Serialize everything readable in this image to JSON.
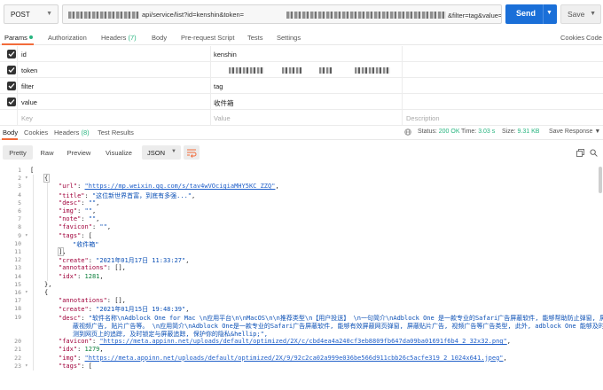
{
  "request": {
    "method": "POST",
    "url_path_visible": "api/service/list?id=kenshin&token=",
    "url_suffix_visible": "&filter=tag&value=收件箱",
    "send_label": "Send",
    "save_label": "Save"
  },
  "request_tabs": {
    "params": "Params",
    "authorization": "Authorization",
    "headers": "Headers",
    "headers_count": "(7)",
    "body": "Body",
    "prerequest": "Pre-request Script",
    "tests": "Tests",
    "settings": "Settings",
    "cookies": "Cookies",
    "code": "Code"
  },
  "params": [
    {
      "key": "id",
      "value": "kenshin",
      "value_redacted": false
    },
    {
      "key": "token",
      "value": "",
      "value_redacted": true
    },
    {
      "key": "filter",
      "value": "tag",
      "value_redacted": false
    },
    {
      "key": "value",
      "value": "收件箱",
      "value_redacted": false
    }
  ],
  "params_placeholder": {
    "key": "Key",
    "value": "Value",
    "description": "Description"
  },
  "response_tabs": {
    "body": "Body",
    "cookies": "Cookies",
    "headers": "Headers",
    "headers_count": "(8)",
    "test_results": "Test Results",
    "status_label": "Status:",
    "status_value": "200 OK",
    "time_label": "Time:",
    "time_value": "3.03 s",
    "size_label": "Size:",
    "size_value": "9.31 KB",
    "save_response": "Save Response"
  },
  "response_toolbar": {
    "pretty": "Pretty",
    "raw": "Raw",
    "preview": "Preview",
    "visualize": "Visualize",
    "format": "JSON"
  },
  "code_lines": [
    {
      "n": "1",
      "text": "[",
      "indent": 0
    },
    {
      "n": "2",
      "text": "{",
      "indent": 1
    },
    {
      "n": "3",
      "k": "\"url\"",
      "v": "\"https://mp.weixin.qq.com/s/tav4wVOcigiaMHY5KC_ZZQ\"",
      "t": "link",
      "indent": 2
    },
    {
      "n": "4",
      "k": "\"title\"",
      "v": "\"这位新世界首富，到底有多强...\"",
      "t": "str",
      "indent": 2
    },
    {
      "n": "5",
      "k": "\"desc\"",
      "v": "\"\"",
      "t": "str",
      "indent": 2
    },
    {
      "n": "6",
      "k": "\"img\"",
      "v": "\"\"",
      "t": "str",
      "indent": 2
    },
    {
      "n": "7",
      "k": "\"note\"",
      "v": "\"\"",
      "t": "str",
      "indent": 2
    },
    {
      "n": "8",
      "k": "\"favicon\"",
      "v": "\"\"",
      "t": "str",
      "indent": 2
    },
    {
      "n": "9",
      "k": "\"tags\"",
      "v": "[",
      "t": "pun",
      "indent": 2
    },
    {
      "n": "10",
      "text": "\"收件箱\"",
      "t": "str",
      "indent": 3
    },
    {
      "n": "11",
      "text": "],",
      "indent": 2
    },
    {
      "n": "12",
      "k": "\"create\"",
      "v": "\"2021年01月17日 11:33:27\"",
      "t": "str",
      "indent": 2
    },
    {
      "n": "13",
      "k": "\"annotations\"",
      "v": "[]",
      "t": "pun",
      "indent": 2
    },
    {
      "n": "14",
      "k": "\"idx\"",
      "v": "1281",
      "t": "num",
      "indent": 2
    },
    {
      "n": "15",
      "text": "},",
      "indent": 1
    },
    {
      "n": "16",
      "text": "{",
      "indent": 1
    },
    {
      "n": "17",
      "k": "\"annotations\"",
      "v": "[]",
      "t": "pun",
      "indent": 2
    },
    {
      "n": "18",
      "k": "\"create\"",
      "v": "\"2021年01月15日 19:48:39\"",
      "t": "str",
      "indent": 2
    },
    {
      "n": "19",
      "k": "\"desc\"",
      "v": "\"软件名称\\nAdblock One for Mac \\n应用平台\\n\\nMacOS\\n\\n推荐类型\\n【用户投送】 \\n一句简介\\nAdblock One 是一款专业的Safari广告屏蔽软件, 能够帮助防止弹窗, 屏",
      "t": "str",
      "indent": 2
    },
    {
      "n": "",
      "text": "蔽视频广告, 贴片广告等。 \\n应用简介\\nAdblock One是一款专业的Safari广告屏蔽软件, 能够有效屏蔽网页弹窗, 屏蔽贴片广告, 视频广告等广告类型, 此外, adblock One 能够及时侦",
      "t": "str",
      "indent": 3
    },
    {
      "n": "",
      "text": "测到网页上的追踪, 及时锁定与屏蔽追踪, 保护你的隐私&hellip;\",",
      "t": "str",
      "indent": 3
    },
    {
      "n": "20",
      "k": "\"favicon\"",
      "v": "\"https://meta.appinn.net/uploads/default/optimized/2X/c/cbd4ea4a240cf3eb8809fb647da09ba01691f6b4_2_32x32.png\"",
      "t": "link",
      "indent": 2
    },
    {
      "n": "21",
      "k": "\"idx\"",
      "v": "1279",
      "t": "num",
      "indent": 2
    },
    {
      "n": "22",
      "k": "\"img\"",
      "v": "\"https://meta.appinn.net/uploads/default/optimized/2X/9/92c2ca02a999e036be566d911cbb26c5acfe319_2_1024x641.jpeg\"",
      "t": "link",
      "indent": 2
    },
    {
      "n": "23",
      "k": "\"tags\"",
      "v": "[",
      "t": "pun",
      "indent": 2
    }
  ],
  "colors": {
    "send": "#1a6fd8",
    "accent": "#f26b3a",
    "status_ok": "#26b47f"
  }
}
